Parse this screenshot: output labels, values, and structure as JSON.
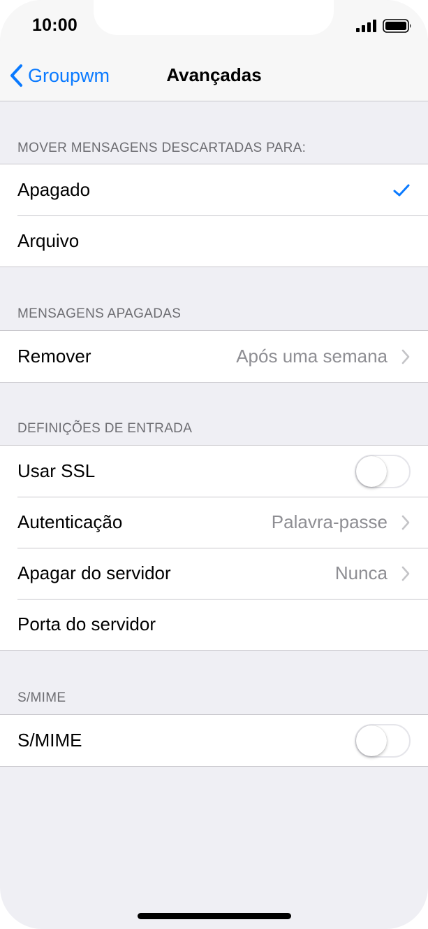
{
  "status": {
    "time": "10:00"
  },
  "nav": {
    "back_label": "Groupwm",
    "title": "Avançadas"
  },
  "sections": {
    "discard": {
      "header": "MOVER MENSAGENS DESCARTADAS PARA:",
      "rows": [
        {
          "label": "Apagado",
          "selected": true
        },
        {
          "label": "Arquivo",
          "selected": false
        }
      ]
    },
    "deleted": {
      "header": "MENSAGENS APAGADAS",
      "rows": [
        {
          "label": "Remover",
          "value": "Após uma semana"
        }
      ]
    },
    "incoming": {
      "header": "DEFINIÇÕES DE ENTRADA",
      "rows": [
        {
          "label": "Usar SSL",
          "toggle": false
        },
        {
          "label": "Autenticação",
          "value": "Palavra-passe"
        },
        {
          "label": "Apagar do servidor",
          "value": "Nunca"
        },
        {
          "label": "Porta do servidor"
        }
      ]
    },
    "smime": {
      "header": "S/MIME",
      "rows": [
        {
          "label": "S/MIME",
          "toggle": false
        }
      ]
    }
  },
  "colors": {
    "accent": "#0a7aff",
    "background": "#efeff4",
    "secondary_text": "#8e8e93"
  }
}
